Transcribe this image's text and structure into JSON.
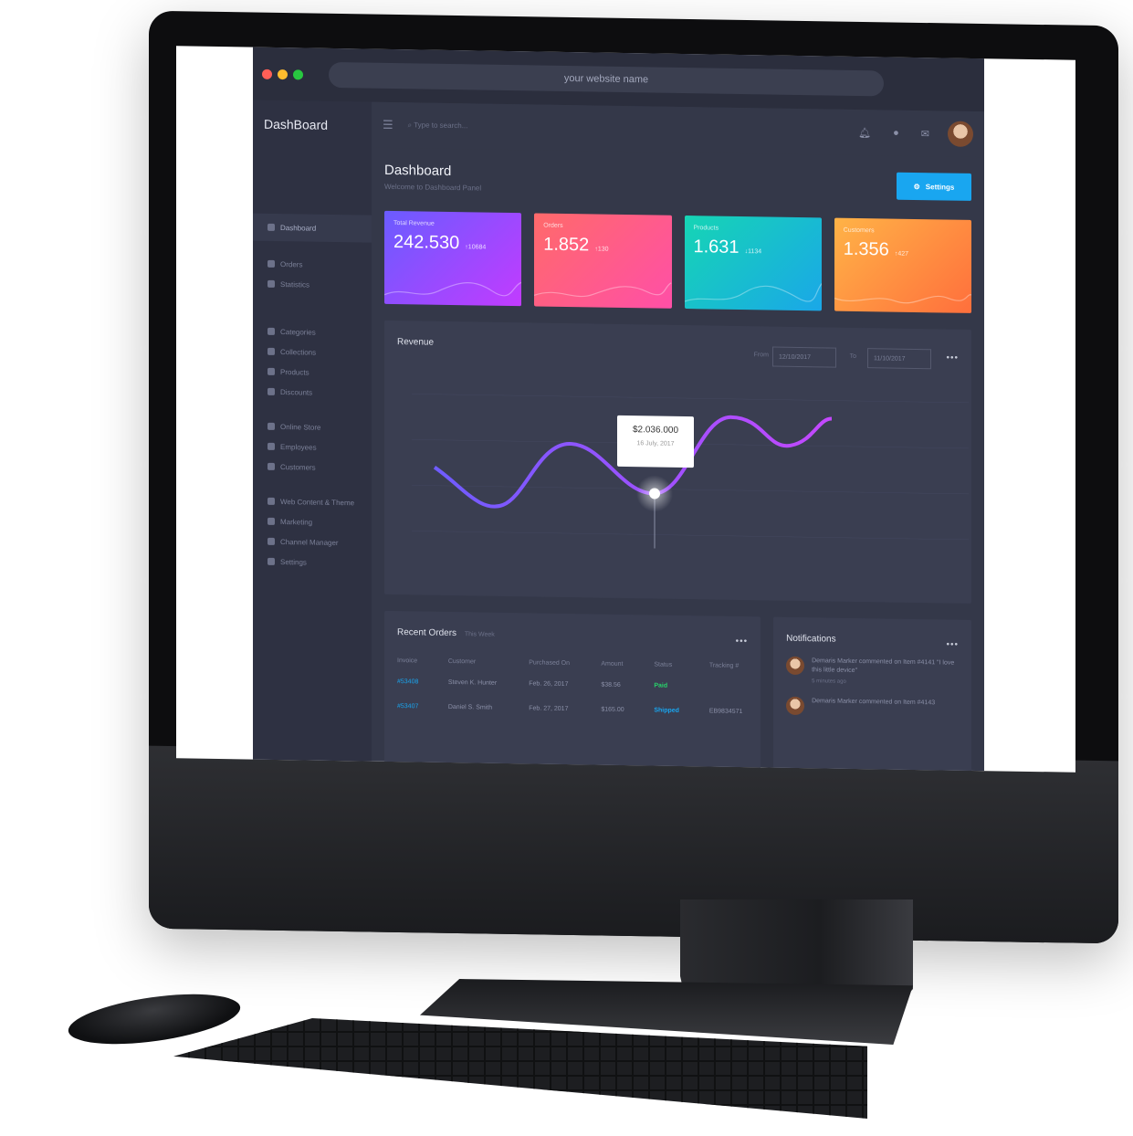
{
  "browser": {
    "url": "your website name"
  },
  "sidebar": {
    "brand": "DashBoard",
    "items": [
      {
        "label": "Dashboard",
        "icon": "home-icon",
        "active": true
      },
      {
        "label": "Orders",
        "icon": "cart-icon"
      },
      {
        "label": "Statistics",
        "icon": "chart-icon"
      },
      {
        "label": "Categories",
        "icon": "list-icon"
      },
      {
        "label": "Collections",
        "icon": "tag-icon"
      },
      {
        "label": "Products",
        "icon": "tag-icon"
      },
      {
        "label": "Discounts",
        "icon": "percent-icon"
      },
      {
        "label": "Online Store",
        "icon": "store-icon"
      },
      {
        "label": "Employees",
        "icon": "user-icon"
      },
      {
        "label": "Customers",
        "icon": "users-icon"
      },
      {
        "label": "Web Content & Theme",
        "icon": "globe-icon"
      },
      {
        "label": "Marketing",
        "icon": "mail-icon"
      },
      {
        "label": "Channel Manager",
        "icon": "layers-icon"
      },
      {
        "label": "Settings",
        "icon": "gear-icon"
      }
    ]
  },
  "topbar": {
    "search_placeholder": "Type to search..."
  },
  "header": {
    "title": "Dashboard",
    "subtitle": "Welcome to Dashboard Panel",
    "settings_label": "Settings"
  },
  "cards": [
    {
      "label": "Total Revenue",
      "value": "242.530",
      "delta": "↑10684"
    },
    {
      "label": "Orders",
      "value": "1.852",
      "delta": "↑130"
    },
    {
      "label": "Products",
      "value": "1.631",
      "delta": "↓1134"
    },
    {
      "label": "Customers",
      "value": "1.356",
      "delta": "↑427"
    }
  ],
  "revenue": {
    "title": "Revenue",
    "from_label": "From",
    "from_value": "12/10/2017",
    "to_label": "To",
    "to_value": "11/10/2017",
    "tooltip_value": "$2.036.000",
    "tooltip_date": "16 July, 2017"
  },
  "orders": {
    "title": "Recent Orders",
    "subtitle": "This Week",
    "columns": [
      "Invoice",
      "Customer",
      "Purchased On",
      "Amount",
      "Status",
      "Tracking #"
    ],
    "rows": [
      [
        "#53408",
        "Steven K. Hunter",
        "Feb. 26, 2017",
        "$38.56",
        "Paid",
        ""
      ],
      [
        "#53407",
        "Daniel S. Smith",
        "Feb. 27, 2017",
        "$165.00",
        "Shipped",
        "EB9834571"
      ]
    ]
  },
  "notifications": {
    "title": "Notifications",
    "items": [
      {
        "text": "Demaris Marker commented on Item #4141 \"I love this little device\"",
        "time": "5 minutes ago"
      },
      {
        "text": "Demaris Marker commented on Item #4143",
        "time": ""
      }
    ]
  },
  "colors": {
    "accent": "#19a6f0",
    "paid": "#28d46a",
    "line": "#8b5cff"
  }
}
